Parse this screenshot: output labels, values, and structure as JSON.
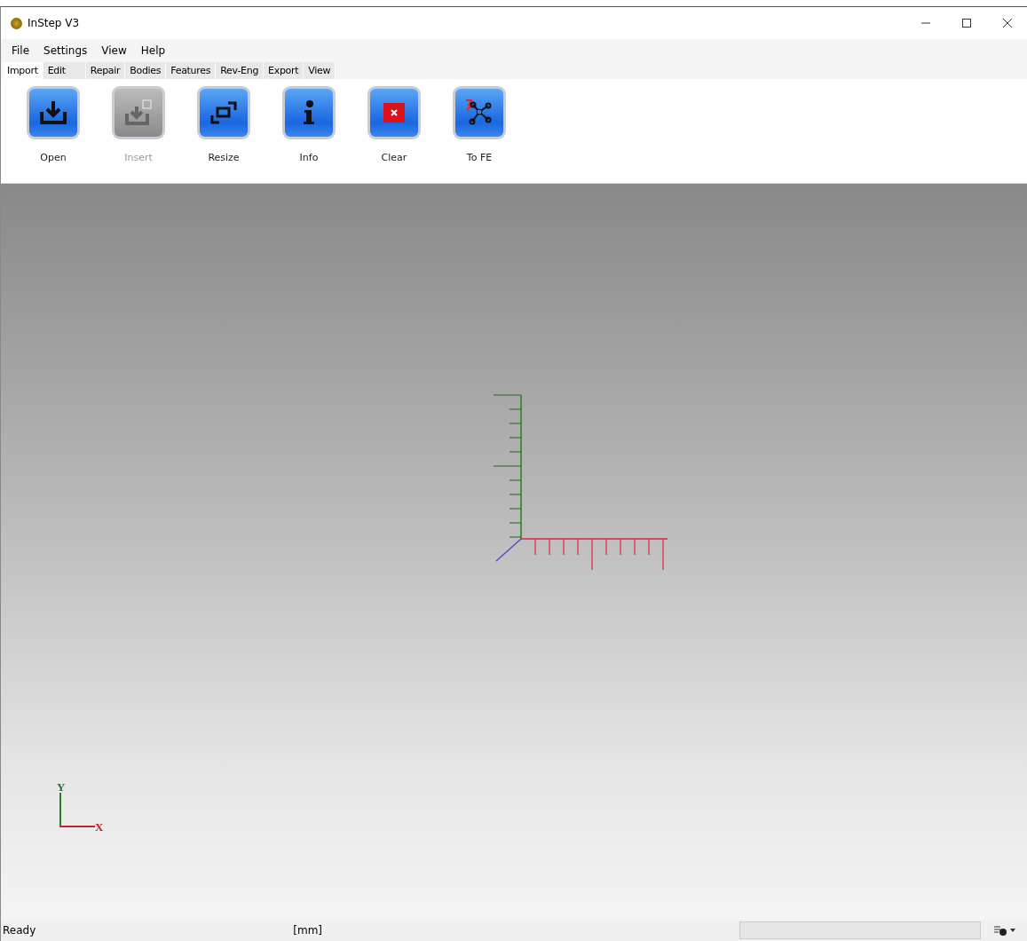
{
  "window": {
    "title": "InStep V3"
  },
  "menu": [
    "File",
    "Settings",
    "View",
    "Help"
  ],
  "tabs": [
    {
      "label": "Import",
      "selected": true
    },
    {
      "label": "Edit",
      "selected": false
    },
    {
      "label": "Repair",
      "selected": false
    },
    {
      "label": "Bodies",
      "selected": false
    },
    {
      "label": "Features",
      "selected": false
    },
    {
      "label": "Rev-Eng",
      "selected": false
    },
    {
      "label": "Export",
      "selected": false
    },
    {
      "label": "View",
      "selected": false
    }
  ],
  "toolbar": [
    {
      "kind": "open",
      "label": "Open",
      "disabled": false
    },
    {
      "kind": "insert",
      "label": "Insert",
      "disabled": true
    },
    {
      "kind": "resize",
      "label": "Resize",
      "disabled": false
    },
    {
      "kind": "info",
      "label": "Info",
      "disabled": false
    },
    {
      "kind": "clear",
      "label": "Clear",
      "disabled": false
    },
    {
      "kind": "tofe",
      "label": "To FE",
      "disabled": false
    }
  ],
  "triad": {
    "y_label": "Y",
    "x_label": "X"
  },
  "status_bar": {
    "message": "Ready",
    "units": "[mm]",
    "progress": {
      "level": 0
    }
  }
}
